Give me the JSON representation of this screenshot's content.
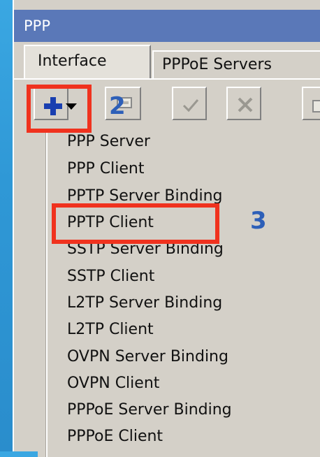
{
  "window": {
    "title": "PPP"
  },
  "tabs": [
    {
      "label": "Interface",
      "active": true
    },
    {
      "label": "PPPoE Servers",
      "active": false
    }
  ],
  "toolbar": {
    "buttons": [
      {
        "icon": "plus-icon",
        "color": "#1a3fb0"
      },
      {
        "icon": "edit-icon"
      },
      {
        "icon": "check-icon"
      },
      {
        "icon": "cross-icon"
      },
      {
        "icon": "copy-icon"
      }
    ]
  },
  "annotations": {
    "step2": "2",
    "step3": "3",
    "highlight_color": "#f0321e",
    "number_color": "#2d5fb8"
  },
  "menu": {
    "items": [
      "PPP Server",
      "PPP Client",
      "PPTP Server Binding",
      "PPTP Client",
      "SSTP Server Binding",
      "SSTP Client",
      "L2TP Server Binding",
      "L2TP Client",
      "OVPN Server Binding",
      "OVPN Client",
      "PPPoE Server Binding",
      "PPPoE Client"
    ]
  }
}
